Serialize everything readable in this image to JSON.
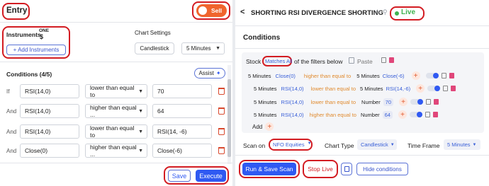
{
  "left": {
    "title": "Entry",
    "sell_label": "Sell",
    "instruments_label": "Instruments",
    "instrument_badge": "ONE",
    "instrument_mark": "$",
    "add_instruments_label": "+ Add Instruments",
    "chart_settings_label": "Chart Settings",
    "candlestick_label": "Candlestick",
    "interval_value": "5 Minutes",
    "conditions_title": "Conditions (4/5)",
    "assist_label": "Assist",
    "rows": [
      {
        "prefix": "If",
        "lhs": "RSI(14,0)",
        "op": "lower than equal to",
        "rhs": "70"
      },
      {
        "prefix": "And",
        "lhs": "RSI(14,0)",
        "op": "higher than equal ...",
        "rhs": "64"
      },
      {
        "prefix": "And",
        "lhs": "RSI(14,0)",
        "op": "lower than equal to",
        "rhs": "RSI(14, -6)"
      },
      {
        "prefix": "And",
        "lhs": "Close(0)",
        "op": "higher than equal ...",
        "rhs": "Close(-6)"
      }
    ],
    "save_label": "Save",
    "execute_label": "Execute"
  },
  "right": {
    "back_glyph": "<",
    "title": "SHORTING RSI DIVERGENCE SHORTING",
    "live_label": "Live",
    "conditions_title": "Conditions",
    "stock_label": "Stock",
    "matches_label": "Matches All",
    "filters_text": "of the filters below",
    "paste_label": "Paste",
    "conditions": [
      {
        "tf": "5 Minutes",
        "lhs": "Close(0)",
        "op": "higher than equal to",
        "rtf": "5 Minutes",
        "rhs": "Close(-6)"
      },
      {
        "tf": "5 Minutes",
        "lhs": "RSI(14,0)",
        "op": "lower than equal to",
        "rtf": "5 Minutes",
        "rhs": "RSI(14,-6)"
      },
      {
        "tf": "5 Minutes",
        "lhs": "RSI(14,0)",
        "op": "lower than equal to",
        "rtf": "Number",
        "rhs": "70"
      },
      {
        "tf": "5 Minutes",
        "lhs": "RSI(14,0)",
        "op": "higher than equal to",
        "rtf": "Number",
        "rhs": "64"
      }
    ],
    "add_label": "Add",
    "scan_on_label": "Scan on",
    "scan_on_value": "NFO Equities",
    "chart_type_label": "Chart Type",
    "chart_type_value": "Candlestick",
    "time_frame_label": "Time Frame",
    "time_frame_value": "5 Minutes",
    "run_save_label": "Run & Save Scan",
    "stop_live_label": "Stop Live",
    "hide_conditions_label": "Hide conditions"
  },
  "colors": {
    "accent": "#2f59f2",
    "danger": "#d31c22",
    "toggle": "#f0642d",
    "live": "#3fb34f"
  }
}
